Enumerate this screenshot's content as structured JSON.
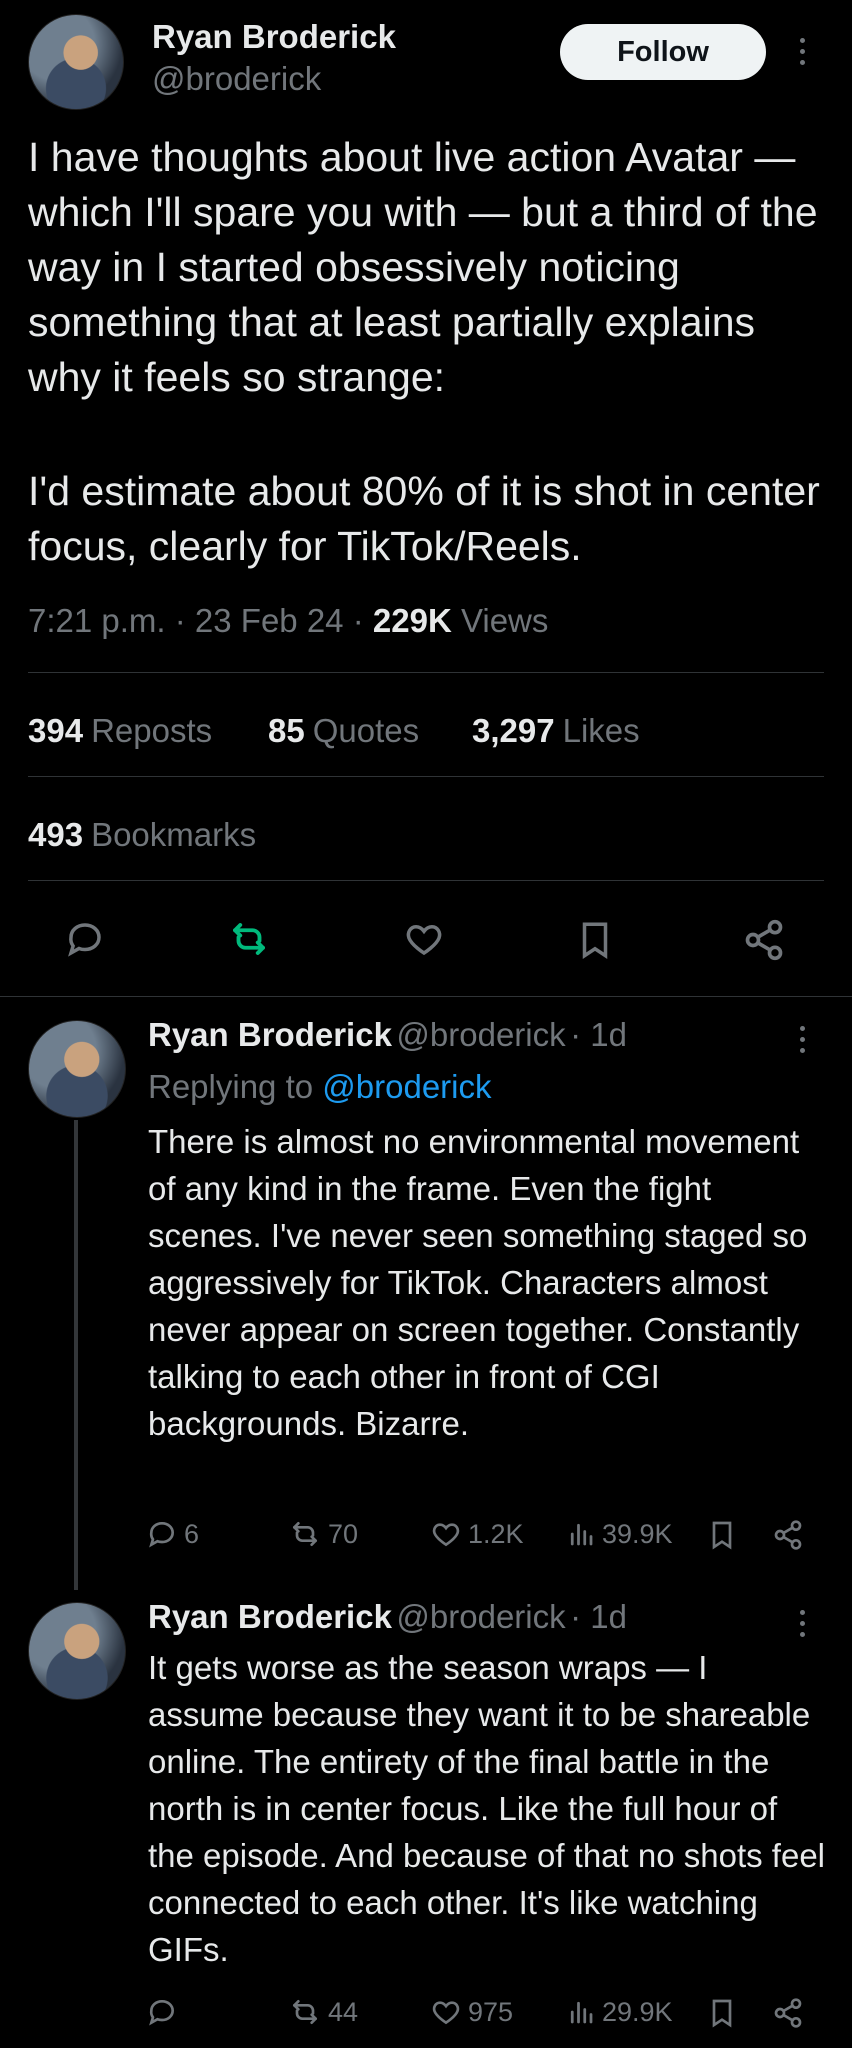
{
  "main_tweet": {
    "author_name": "Ryan Broderick",
    "author_handle": "@broderick",
    "follow_label": "Follow",
    "text_p1": "I have thoughts about live action Avatar — which I'll spare you with — but a third of the way in I started obsessively noticing something that at least partially explains why it feels so strange:",
    "text_p2": "I'd estimate about 80% of it is shot in center focus, clearly for TikTok/Reels.",
    "time": "7:21 p.m.",
    "date": "23 Feb 24",
    "views_count": "229K",
    "views_label": "Views",
    "reposts_count": "394",
    "reposts_label": "Reposts",
    "quotes_count": "85",
    "quotes_label": "Quotes",
    "likes_count": "3,297",
    "likes_label": "Likes",
    "bookmarks_count": "493",
    "bookmarks_label": "Bookmarks",
    "icons": [
      "reply-icon",
      "repost-icon",
      "like-icon",
      "bookmark-icon",
      "share-icon"
    ],
    "repost_color": "#00ba7c"
  },
  "replies": [
    {
      "author_name": "Ryan Broderick",
      "author_handle": "@broderick",
      "age": "· 1d",
      "replying_label": "Replying to",
      "replying_handle": "@broderick",
      "text": "There is almost no environmental movement of any kind in the frame. Even the fight scenes. I've never seen something staged so aggressively for TikTok. Characters almost never appear on screen together. Constantly talking to each other in front of CGI backgrounds. Bizarre.",
      "reply_count": "6",
      "repost_count": "70",
      "like_count": "1.2K",
      "view_count": "39.9K"
    },
    {
      "author_name": "Ryan Broderick",
      "author_handle": "@broderick",
      "age": "· 1d",
      "text": "It gets worse as the season wraps — I assume because they want it to be shareable online. The entirety of the final battle in the north is in center focus. Like the full hour of the episode. And because of that no shots feel connected to each other. It's like watching GIFs.",
      "reply_count": "",
      "repost_count": "44",
      "like_count": "975",
      "view_count": "29.9K"
    }
  ],
  "colors": {
    "background": "#000000",
    "text": "#e7e9ea",
    "muted": "#71767b",
    "link": "#1d9bf0",
    "divider": "#2f3336"
  }
}
